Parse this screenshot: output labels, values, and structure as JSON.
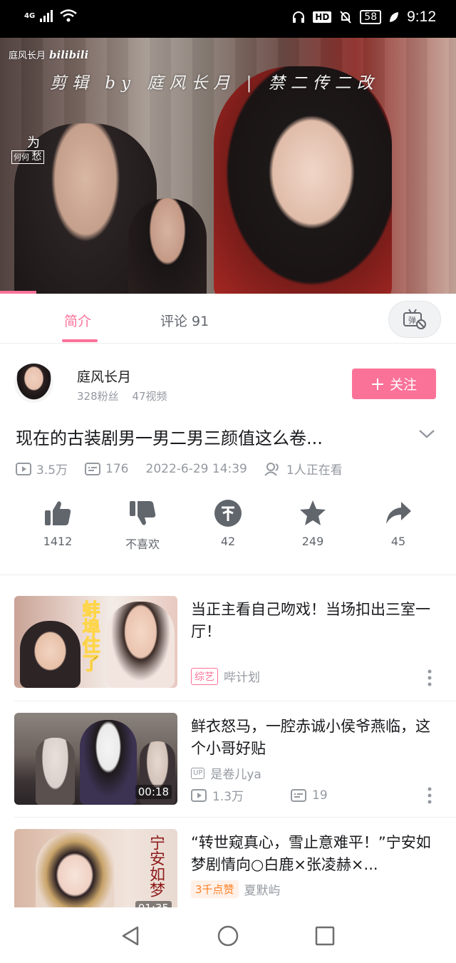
{
  "status_bar": {
    "network": "4G",
    "battery": "58",
    "hd": "HD",
    "time": "9:12"
  },
  "video": {
    "logo_name": "庭风长月",
    "logo_brand": "bilibili",
    "caption": "剪辑 by 庭风长月 | 禁二传二改",
    "seal_top": "为",
    "seal_mid": "何",
    "seal_right": "愁",
    "progress_fraction": 0.08
  },
  "tabs": {
    "intro": "简介",
    "comments": "评论 91",
    "danmaku_icon": "danmaku-off-icon"
  },
  "uploader": {
    "name": "庭风长月",
    "fans": "328粉丝",
    "videos": "47视频",
    "follow_label": "关注"
  },
  "video_info": {
    "title": "现在的古装剧男一男二男三颜值这么卷...",
    "views": "3.5万",
    "danmaku": "176",
    "date": "2022-6-29 14:39",
    "watching": "1人正在看"
  },
  "actions": {
    "like": "1412",
    "dislike": "不喜欢",
    "coin": "42",
    "favorite": "249",
    "share": "45"
  },
  "recommendations": [
    {
      "title": "当正主看自己吻戏！当场扣出三室一厅！",
      "tag": "综艺",
      "owner": "哔计划",
      "thumb_text": "蚌埠住了"
    },
    {
      "title": "鲜衣怒马，一腔赤诚小侯爷燕临，这个小哥好贴",
      "up_badge": "UP",
      "owner": "是卷儿ya",
      "views": "1.3万",
      "danmaku": "19",
      "duration": "00:18"
    },
    {
      "title": "“转世窥真心，雪止意难平！”宁安如梦剧情向○白鹿×张凌赫×...",
      "tag": "3千点赞",
      "owner": "夏默屿",
      "duration": "01:35",
      "thumb_text": "宁安如梦"
    }
  ],
  "colors": {
    "accent": "#fb7299",
    "text_secondary": "#9499a0"
  }
}
